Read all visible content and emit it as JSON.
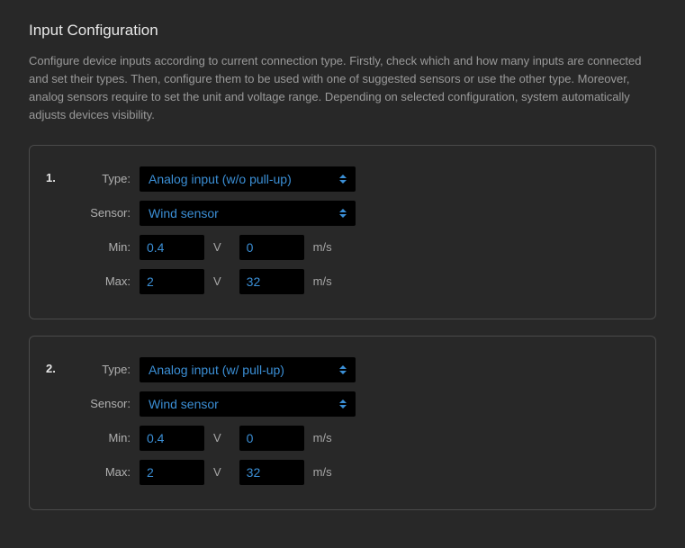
{
  "title": "Input Configuration",
  "description": "Configure device inputs according to current connection type. Firstly, check which and how many inputs are connected and set their types. Then, configure them to be used with one of suggested sensors or use the other type. Moreover, analog sensors require to set the unit and voltage range. Depending on selected configuration, system automatically adjusts devices visibility.",
  "labels": {
    "type": "Type:",
    "sensor": "Sensor:",
    "min": "Min:",
    "max": "Max:"
  },
  "units": {
    "volts": "V",
    "speed": "m/s"
  },
  "inputs": [
    {
      "index": "1.",
      "type": "Analog input (w/o pull-up)",
      "sensor": "Wind sensor",
      "min_v": "0.4",
      "min_val": "0",
      "max_v": "2",
      "max_val": "32"
    },
    {
      "index": "2.",
      "type": "Analog input (w/ pull-up)",
      "sensor": "Wind sensor",
      "min_v": "0.4",
      "min_val": "0",
      "max_v": "2",
      "max_val": "32"
    }
  ]
}
